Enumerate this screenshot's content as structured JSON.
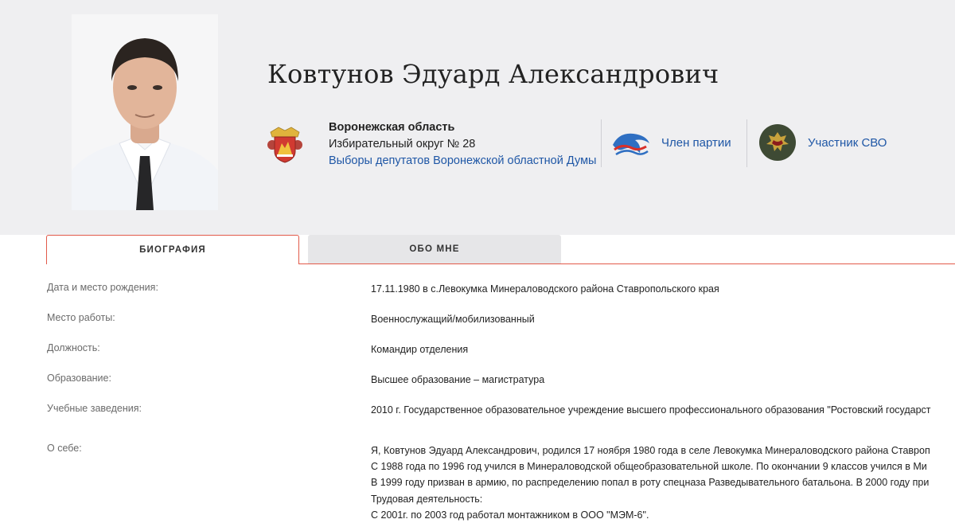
{
  "profile": {
    "name": "Ковтунов Эдуард Александрович",
    "region": "Воронежская область",
    "district": "Избирательный округ № 28",
    "elections": "Выборы депутатов Воронежской областной Думы",
    "party": "Член партии",
    "svo": "Участник СВО"
  },
  "tabs": {
    "bio": "БИОГРАФИЯ",
    "about": "ОБО МНЕ"
  },
  "bio": {
    "birth_label": "Дата и место рождения:",
    "birth_value": "17.11.1980 в с.Левокумка Минераловодского района Ставропольского края",
    "work_label": "Место работы:",
    "work_value": "Военнослужащий/мобилизованный",
    "position_label": "Должность:",
    "position_value": "Командир отделения",
    "education_label": "Образование:",
    "education_value": "Высшее образование – магистратура",
    "schools_label": "Учебные заведения:",
    "schools_value": "2010 г. Государственное образовательное учреждение высшего профессионального образования \"Ростовский государст",
    "about_label": "О себе:",
    "about_lines": [
      "Я, Ковтунов Эдуард Александрович, родился 17 ноября 1980 года в селе Левокумка Минераловодского района Ставроп",
      "С 1988 года по 1996 год учился в Минераловодской общеобразовательной школе. По окончании 9 классов учился в Ми",
      "В 1999 году призван в армию, по распределению попал в роту спецназа Разведывательного батальона. В 2000 году при",
      "Трудовая деятельность:",
      "С 2001г. по 2003 год работал монтажником в ООО \"МЭМ-6\"."
    ]
  },
  "colors": {
    "header_bg": "#efeff1",
    "link": "#1f57a6",
    "tab_accent": "#e25a4a",
    "tab_inactive_bg": "#e6e6e8",
    "label_gray": "#6a6a6a"
  },
  "icons": {
    "emblem": "voronezh-coat-of-arms-icon",
    "party": "united-russia-bear-icon",
    "svo": "armed-forces-emblem-icon"
  }
}
